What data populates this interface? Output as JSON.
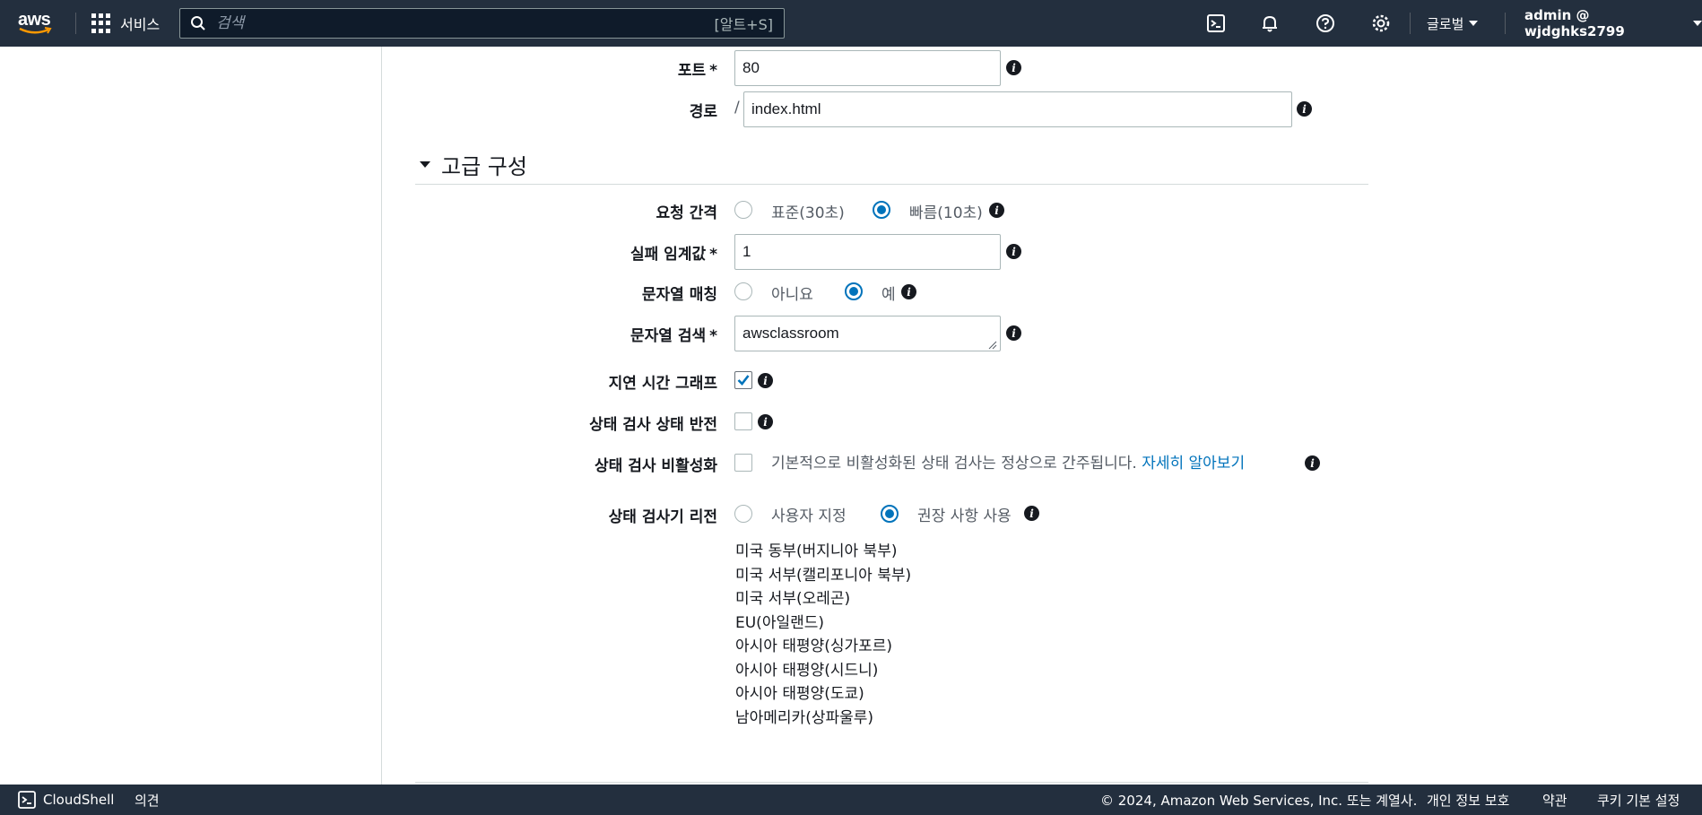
{
  "topbar": {
    "logo_text": "aws",
    "services_label": "서비스",
    "search_placeholder": "검색",
    "search_shortcut": "[알트+S]",
    "region_label": "글로벌",
    "account_label": "admin @ wjdghks2799"
  },
  "form": {
    "port": {
      "label": "포트",
      "required_mark": "*",
      "value": "80"
    },
    "path": {
      "label": "경로",
      "prefix": "/",
      "value": "index.html"
    },
    "advanced_section_title": "고급 구성",
    "request_interval": {
      "label": "요청 간격",
      "options": [
        "표준(30초)",
        "빠름(10초)"
      ],
      "selected": "빠름(10초)"
    },
    "failure_threshold": {
      "label": "실패 임계값",
      "required_mark": "*",
      "value": "1"
    },
    "string_matching": {
      "label": "문자열 매칭",
      "options": [
        "아니요",
        "예"
      ],
      "selected": "예"
    },
    "search_string": {
      "label": "문자열 검색",
      "required_mark": "*",
      "value": "awsclassroom"
    },
    "latency_graphs": {
      "label": "지연 시간 그래프",
      "checked": true
    },
    "invert_health_check": {
      "label": "상태 검사 상태 반전",
      "checked": false
    },
    "disable_health_check": {
      "label": "상태 검사 비활성화",
      "checked": false,
      "note": "기본적으로 비활성화된 상태 검사는 정상으로 간주됩니다.",
      "link": "자세히 알아보기"
    },
    "health_checker_regions": {
      "label": "상태 검사기 리전",
      "options": [
        "사용자 지정",
        "권장 사항 사용"
      ],
      "selected": "권장 사항 사용",
      "regions": [
        "미국 동부(버지니아 북부)",
        "미국 서부(캘리포니아 북부)",
        "미국 서부(오레곤)",
        "EU(아일랜드)",
        "아시아 태평양(싱가포르)",
        "아시아 태평양(시드니)",
        "아시아 태평양(도쿄)",
        "남아메리카(상파울루)"
      ]
    }
  },
  "footer": {
    "cloudshell": "CloudShell",
    "feedback": "의견",
    "copyright": "© 2024, Amazon Web Services, Inc. 또는 계열사.",
    "privacy": "개인 정보 보호",
    "terms": "약관",
    "cookies": "쿠키 기본 설정"
  },
  "colors": {
    "topbar_bg": "#232f3e",
    "accent": "#0073bb",
    "link": "#0073bb"
  }
}
